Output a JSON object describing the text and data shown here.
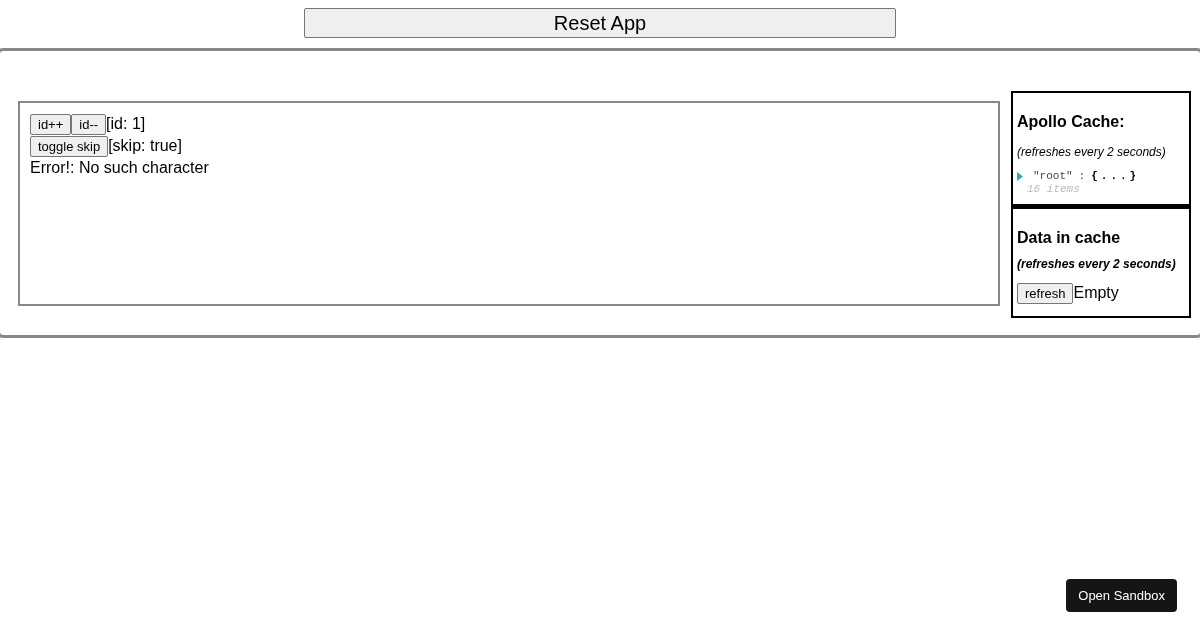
{
  "reset_button": "Reset App",
  "query_panel": {
    "id_buttons": [
      "id++",
      "id--"
    ],
    "id_label": "[id: 1]",
    "skip_button": "toggle skip",
    "skip_label": "[skip: true]",
    "error": "Error!: No such character"
  },
  "apollo_cache": {
    "title": "Apollo Cache:",
    "note": "(refreshes every 2 seconds)",
    "tree": [
      {
        "key": "\"root\"",
        "separator": ":",
        "value": "{...}",
        "count": "16 items",
        "expanded": false
      }
    ]
  },
  "data_in_cache": {
    "title": "Data in cache",
    "note": "(refreshes every 2 seconds)",
    "refresh_button": "refresh",
    "value": "Empty"
  },
  "sandbox_button": "Open Sandbox"
}
